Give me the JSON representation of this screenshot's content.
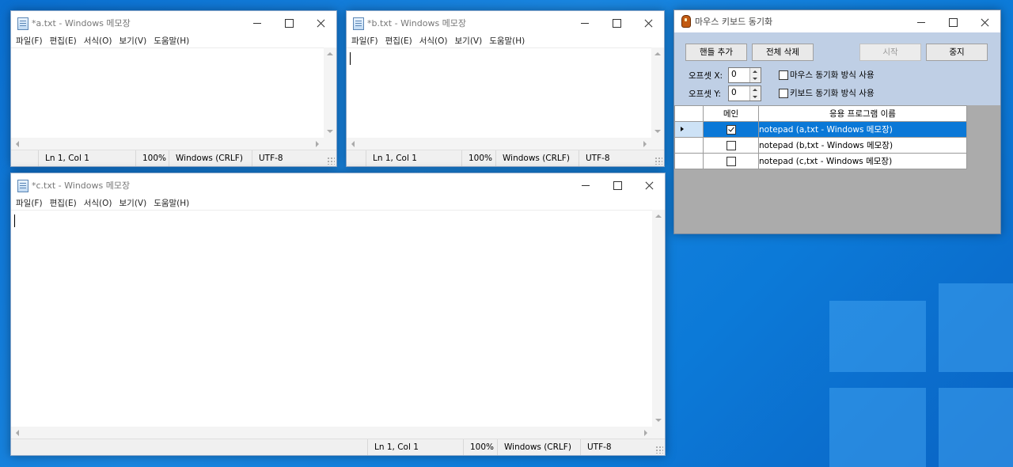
{
  "desktop": {
    "background": "#0b74d6"
  },
  "notepad_common": {
    "menu": [
      "파일(F)",
      "편집(E)",
      "서식(O)",
      "보기(V)",
      "도움말(H)"
    ],
    "status": {
      "position": "Ln 1, Col 1",
      "zoom": "100%",
      "line_ending": "Windows (CRLF)",
      "encoding": "UTF-8"
    }
  },
  "windows": {
    "a": {
      "title": "*a.txt - Windows 메모장"
    },
    "b": {
      "title": "*b.txt - Windows 메모장"
    },
    "c": {
      "title": "*c.txt - Windows 메모장"
    }
  },
  "sync_tool": {
    "title": "마우스 키보드 동기화",
    "buttons": {
      "add_handle": "핸들 추가",
      "delete_all": "전체 삭제",
      "start": "시작",
      "stop": "중지"
    },
    "offset_x_label": "오프셋 X:",
    "offset_x_value": "0",
    "offset_y_label": "오프셋 Y:",
    "offset_y_value": "0",
    "mouse_sync_label": "마우스 동기화 방식 사용",
    "keyboard_sync_label": "키보드 동기화 방식 사용",
    "mouse_sync_checked": false,
    "keyboard_sync_checked": false,
    "grid": {
      "headers": {
        "main": "메인",
        "app_name": "응용 프로그램 이름"
      },
      "rows": [
        {
          "main": true,
          "name": "notepad  (a,txt - Windows 메모장)",
          "selected": true
        },
        {
          "main": false,
          "name": "notepad  (b,txt - Windows 메모장)",
          "selected": false
        },
        {
          "main": false,
          "name": "notepad  (c,txt - Windows 메모장)",
          "selected": false
        }
      ]
    },
    "accent": "#0a78d7",
    "panel_color": "#bfcfe5"
  }
}
